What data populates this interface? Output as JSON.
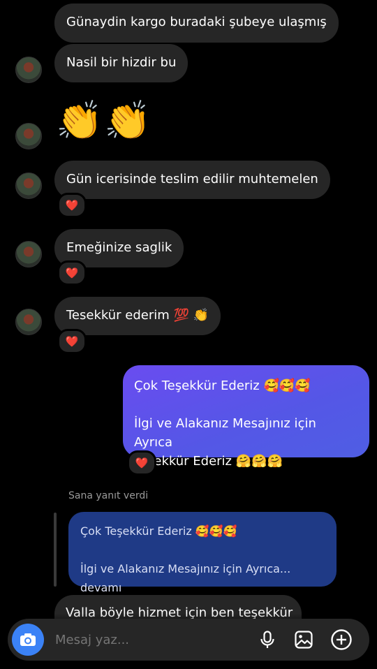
{
  "messages": {
    "m1": "Günaydin kargo buradaki şubeye ulaşmış",
    "m2": "Nasil bir hizdir bu",
    "m3_emoji": "👏👏",
    "m4": "Gün icerisinde teslim edilir muhtemelen",
    "m5": "Emeğinize saglik",
    "m6": "Tesekkür ederim 💯 👏",
    "reaction": "❤️",
    "out_line1": "Çok Teşekkür Ederiz 🥰🥰🥰",
    "out_line2": "İlgi ve Alakanız Mesajınız için Ayrıca",
    "out_line3": "Teşekkür Ederiz 🤗🤗🤗",
    "reply_label": "Sana yanıt verdi",
    "reply_quote_line1": "Çok Teşekkür Ederiz 🥰🥰🥰",
    "reply_quote_line2": "İlgi ve Alakanız Mesajınız için Ayrıca... devamı",
    "last": "Valla böyle hizmet için ben teşekkür"
  },
  "composer": {
    "placeholder": "Mesaj yaz..."
  },
  "icons": {
    "camera": "camera-icon",
    "mic": "microphone-icon",
    "gallery": "gallery-icon",
    "add": "add-icon"
  }
}
